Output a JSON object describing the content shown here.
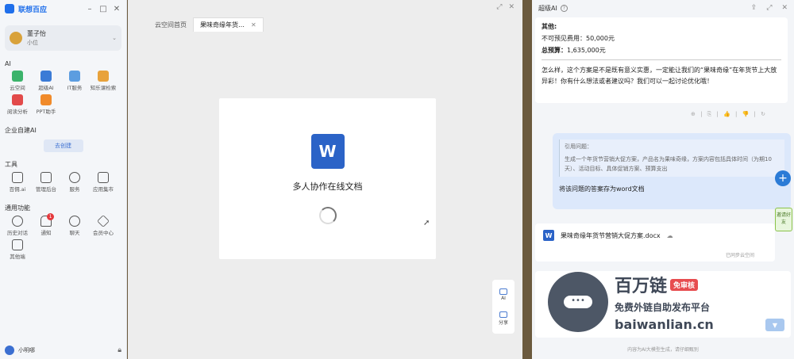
{
  "left_app": {
    "title": "联想百应",
    "user": {
      "name": "董子怡",
      "role": "小位"
    },
    "ai_section": {
      "title": "AI",
      "tiles": [
        {
          "label": "云空间",
          "color": "#3bb36b"
        },
        {
          "label": "超级AI",
          "color": "#3b7bd6"
        },
        {
          "label": "IT服务",
          "color": "#5c9de0"
        },
        {
          "label": "知乐课检索",
          "color": "#e8a23b"
        },
        {
          "label": "阅读分析",
          "color": "#e24a4a"
        },
        {
          "label": "PPT助手",
          "color": "#f08a2a"
        }
      ]
    },
    "enterprise_section": {
      "title": "企业自建AI",
      "create_label": "去创建"
    },
    "tools_section": {
      "title": "工具",
      "tiles": [
        {
          "label": "百佣.ai",
          "icon": "monitor-icon"
        },
        {
          "label": "管理后台",
          "icon": "admin-icon"
        },
        {
          "label": "服务",
          "icon": "service-icon"
        },
        {
          "label": "应用集市",
          "icon": "shop-icon"
        }
      ]
    },
    "common_section": {
      "title": "通用功能",
      "tiles": [
        {
          "label": "历史对话",
          "icon": "clock-icon"
        },
        {
          "label": "通知",
          "icon": "bell-icon",
          "badge": "1"
        },
        {
          "label": "聊天",
          "icon": "chat-icon"
        },
        {
          "label": "会员中心",
          "icon": "diamond-icon"
        },
        {
          "label": "其他端",
          "icon": "devices-icon"
        }
      ]
    },
    "footer_user": "小明哪"
  },
  "doc_window": {
    "tabs": [
      {
        "label": "云空间首页",
        "active": false
      },
      {
        "label": "果味奇缘年货…",
        "active": true
      }
    ],
    "doc_title": "多人协作在线文档",
    "word_letter": "W",
    "tools": [
      {
        "label": "AI"
      },
      {
        "label": "分享"
      }
    ]
  },
  "ai_panel": {
    "title": "超级AI",
    "reply": {
      "other_label": "其他:",
      "unforeseen": "不可预见费用：50,000元",
      "total_label": "总预算：",
      "total_value": "1,635,000元",
      "paragraph": "怎么样，这个方案是不是既有意义实惠，一定能让我们的“果味奇缘”在年货节上大放异彩！你有什么想法或者建议吗？我们可以一起讨论优化哦！"
    },
    "actions": "⊕ | ⎘ | 👍 | 👎 | ↻",
    "user_message": {
      "quote_label": "引用问题：",
      "quote_text": "生成一个年货节营销大促方案，产品名为果味奇缘，方案内容包括具体时间（为期10天）、活动目标、具体促销方案、预算支出",
      "text": "将该问题的答案存为word文档"
    },
    "file": {
      "name": "果味奇缘年货节营销大促方案.docx",
      "sync_label": "已同步云空间"
    },
    "invite_label": "邀请好友",
    "disclaimer": "内容为AI大模型生成，请仔细甄别"
  },
  "watermark": {
    "brand": "百万链",
    "tag": "免审核",
    "slogan": "免费外链自助发布平台",
    "url": "baiwanlian.cn"
  }
}
